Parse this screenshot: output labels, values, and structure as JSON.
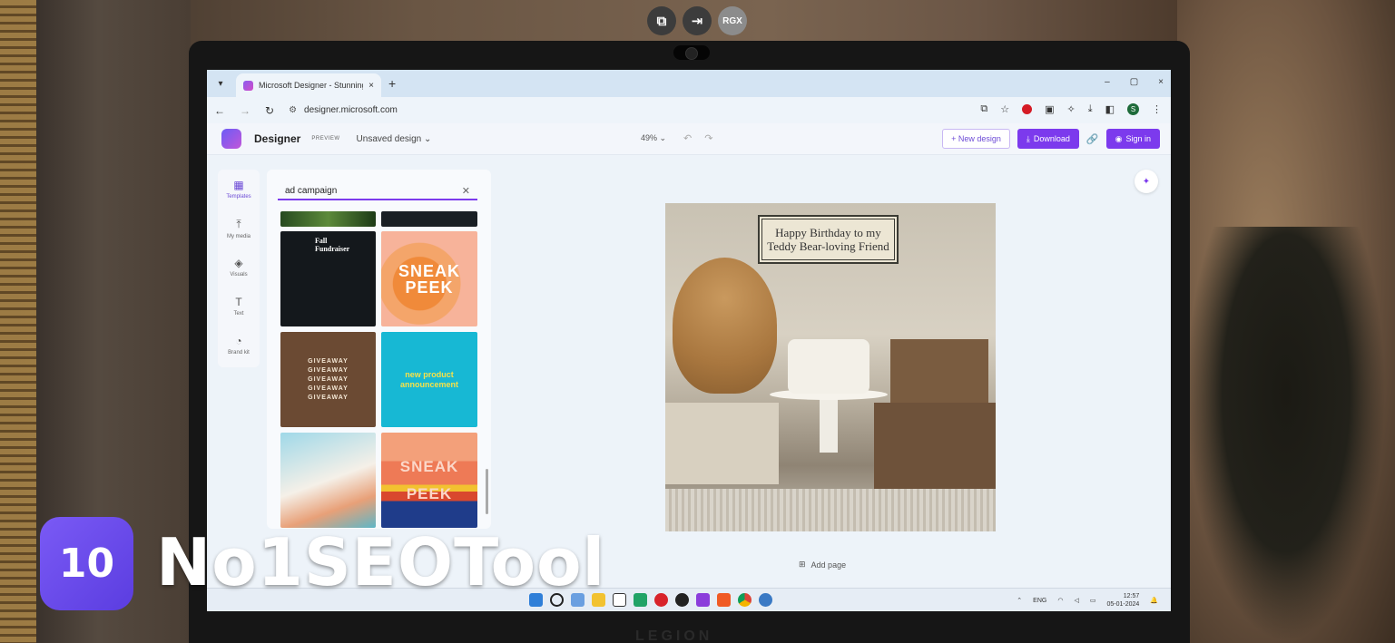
{
  "overlay": {
    "buttons": [
      {
        "icon": "copy-icon"
      },
      {
        "icon": "exit-icon"
      },
      {
        "label": "RGX"
      }
    ]
  },
  "browser": {
    "tab_title": "Microsoft Designer - Stunning",
    "tab_close": "×",
    "new_tab": "+",
    "url": "designer.microsoft.com",
    "profile_initial": "S",
    "window_controls": [
      "–",
      "▢",
      "×"
    ]
  },
  "designer": {
    "app_name": "Designer",
    "badge": "PREVIEW",
    "doc_name": "Unsaved design",
    "zoom": "49%",
    "new_design": "New design",
    "download": "Download",
    "sign_in": "Sign in",
    "rail": [
      {
        "label": "Templates",
        "icon": "templates-icon"
      },
      {
        "label": "My media",
        "icon": "upload-icon"
      },
      {
        "label": "Visuals",
        "icon": "visuals-icon"
      },
      {
        "label": "Text",
        "icon": "text-icon"
      },
      {
        "label": "Brand kit",
        "icon": "brand-kit-icon"
      }
    ],
    "search_value": "ad campaign",
    "templates": [
      {
        "text": "Fall\nFundraiser"
      },
      {
        "text": "SNEAK\nPEEK"
      },
      {
        "text": "GIVEAWAY\nGIVEAWAY\nGIVEAWAY\nGIVEAWAY\nGIVEAWAY"
      },
      {
        "text": "new product\nannouncement"
      },
      {
        "text": ""
      },
      {
        "text": "SNEAK\nPEEK"
      }
    ],
    "canvas_sign_line1": "Happy Birthday to my",
    "canvas_sign_line2": "Teddy Bear-loving Friend",
    "add_page": "Add page"
  },
  "taskbar": {
    "lang": "ENG",
    "time": "12:57",
    "date": "05-01-2024"
  },
  "laptop_brand": "LEGION",
  "watermark": {
    "logo_text": "10",
    "text": "No1SEOTool"
  },
  "colors": {
    "accent": "#7c3aed",
    "taskbar": "#e6edf5"
  }
}
